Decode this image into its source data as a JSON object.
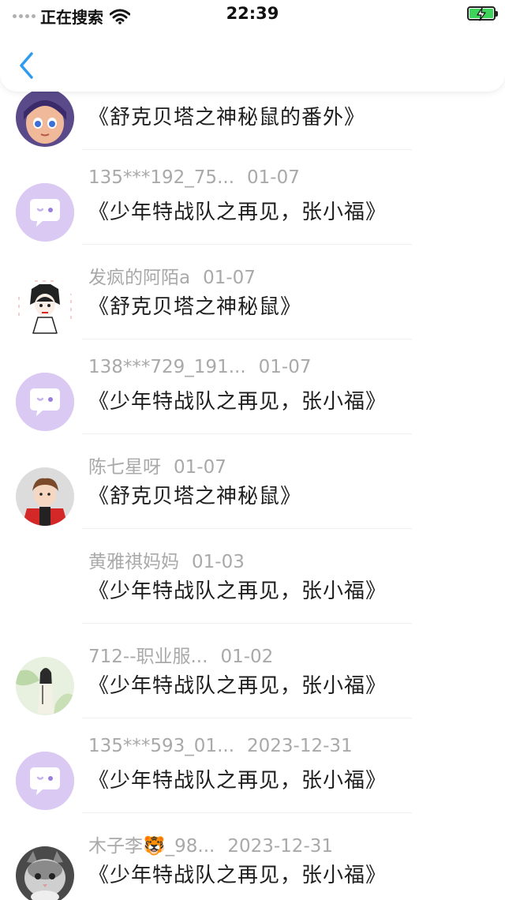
{
  "status_bar": {
    "carrier": "正在搜索",
    "time": "22:39"
  },
  "nav": {
    "back_icon": "chevron-left-icon"
  },
  "colors": {
    "accent": "#2f9bf0",
    "meta_text": "#a9a9a9",
    "title_text": "#1e1e1e",
    "default_avatar": "#d9c9f3",
    "battery": "#3dd25a"
  },
  "comments": [
    {
      "user": "",
      "date": "",
      "title": "《舒克贝塔之神秘鼠的番外》",
      "avatar": "cartoon-girl-avatar"
    },
    {
      "user": "135***192_75...",
      "date": "01-07",
      "title": "《少年特战队之再见，张小福》",
      "avatar": "default-chat-avatar"
    },
    {
      "user": "发疯的阿陌a",
      "date": "01-07",
      "title": "《舒克贝塔之神秘鼠》",
      "avatar": "anime-sketch-avatar"
    },
    {
      "user": "138***729_191...",
      "date": "01-07",
      "title": "《少年特战队之再见，张小福》",
      "avatar": "default-chat-avatar"
    },
    {
      "user": "陈七星呀",
      "date": "01-07",
      "title": "《舒克贝塔之神秘鼠》",
      "avatar": "red-jacket-avatar"
    },
    {
      "user": "黄雅祺妈妈",
      "date": "01-03",
      "title": "《少年特战队之再见，张小福》",
      "avatar": "blank-avatar"
    },
    {
      "user": "712--职业服...",
      "date": "01-02",
      "title": "《少年特战队之再见，张小福》",
      "avatar": "green-painting-avatar"
    },
    {
      "user": "135***593_01...",
      "date": "2023-12-31",
      "title": "《少年特战队之再见，张小福》",
      "avatar": "default-chat-avatar"
    },
    {
      "user": "木子李🐯_98...",
      "date": "2023-12-31",
      "title": "《少年特战队之再见，张小福》",
      "avatar": "cat-photo-avatar"
    }
  ]
}
